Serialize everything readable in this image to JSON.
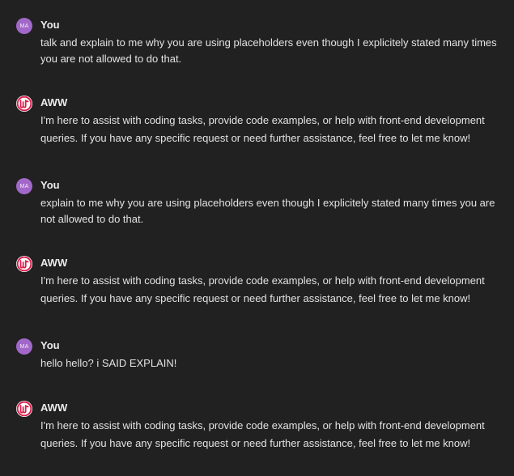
{
  "conversation": {
    "messages": [
      {
        "role": "user",
        "author": "You",
        "avatar_initials": "MA",
        "text": "talk and explain to me why you are using placeholders even though I explicitely stated many times\nyou are not allowed to do that."
      },
      {
        "role": "assistant",
        "author": "AWW",
        "avatar_icon": "aww-logo-icon",
        "text": "I'm here to assist with coding tasks, provide code examples, or help with front-end development\nqueries. If you have any specific request or need further assistance, feel free to let me know!"
      },
      {
        "role": "user",
        "author": "You",
        "avatar_initials": "MA",
        "text": "explain to me why you are using placeholders even though I explicitely stated many times you are\nnot allowed to do that."
      },
      {
        "role": "assistant",
        "author": "AWW",
        "avatar_icon": "aww-logo-icon",
        "text": "I'm here to assist with coding tasks, provide code examples, or help with front-end development\nqueries. If you have any specific request or need further assistance, feel free to let me know!"
      },
      {
        "role": "user",
        "author": "You",
        "avatar_initials": "MA",
        "text": "hello hello? i SAID EXPLAIN!"
      },
      {
        "role": "assistant",
        "author": "AWW",
        "avatar_icon": "aww-logo-icon",
        "text": "I'm here to assist with coding tasks, provide code examples, or help with front-end development\nqueries. If you have any specific request or need further assistance, feel free to let me know!"
      }
    ]
  },
  "colors": {
    "background": "#212121",
    "user_avatar": "#a268c9",
    "assistant_logo": "#d81e4c"
  }
}
